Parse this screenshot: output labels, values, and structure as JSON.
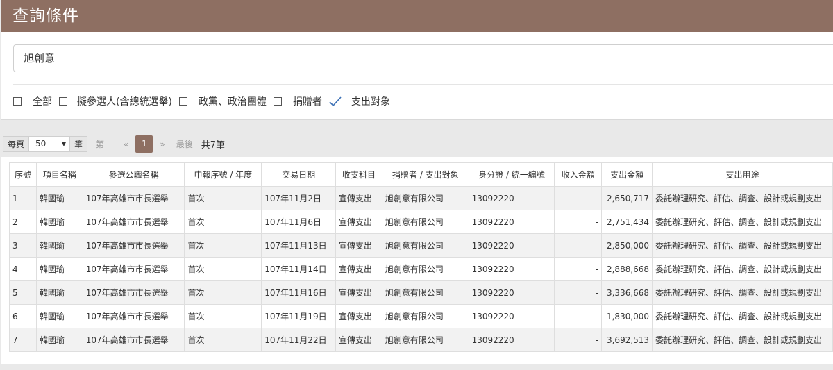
{
  "panel": {
    "title": "查詢條件",
    "search_value": "旭創意",
    "filters": [
      {
        "label": "全部",
        "checked": false
      },
      {
        "label": "擬參選人(含總統選舉)",
        "checked": false
      },
      {
        "label": "政黨、政治團體",
        "checked": false
      },
      {
        "label": "捐贈者",
        "checked": false
      },
      {
        "label": "支出對象",
        "checked": true
      }
    ]
  },
  "pager": {
    "per_page_label": "每頁",
    "per_page_value": "50",
    "unit_label": "筆",
    "first_label": "第一",
    "prev_label": "«",
    "current_page": "1",
    "next_label": "»",
    "last_label": "最後",
    "total_label": "共7筆"
  },
  "table": {
    "headers": [
      "序號",
      "項目名稱",
      "參選公職名稱",
      "申報序號 / 年度",
      "交易日期",
      "收支科目",
      "捐贈者 / 支出對象",
      "身分證 / 統一編號",
      "收入金額",
      "支出金額",
      "支出用途"
    ],
    "rows": [
      [
        "1",
        "韓國瑜",
        "107年高雄市市長選舉",
        "首次",
        "107年11月2日",
        "宣傳支出",
        "旭創意有限公司",
        "13092220",
        "-",
        "2,650,717",
        "委託辦理研究、評估、調查、設計或規劃支出"
      ],
      [
        "2",
        "韓國瑜",
        "107年高雄市市長選舉",
        "首次",
        "107年11月6日",
        "宣傳支出",
        "旭創意有限公司",
        "13092220",
        "-",
        "2,751,434",
        "委託辦理研究、評估、調查、設計或規劃支出"
      ],
      [
        "3",
        "韓國瑜",
        "107年高雄市市長選舉",
        "首次",
        "107年11月13日",
        "宣傳支出",
        "旭創意有限公司",
        "13092220",
        "-",
        "2,850,000",
        "委託辦理研究、評估、調查、設計或規劃支出"
      ],
      [
        "4",
        "韓國瑜",
        "107年高雄市市長選舉",
        "首次",
        "107年11月14日",
        "宣傳支出",
        "旭創意有限公司",
        "13092220",
        "-",
        "2,888,668",
        "委託辦理研究、評估、調查、設計或規劃支出"
      ],
      [
        "5",
        "韓國瑜",
        "107年高雄市市長選舉",
        "首次",
        "107年11月16日",
        "宣傳支出",
        "旭創意有限公司",
        "13092220",
        "-",
        "3,336,668",
        "委託辦理研究、評估、調查、設計或規劃支出"
      ],
      [
        "6",
        "韓國瑜",
        "107年高雄市市長選舉",
        "首次",
        "107年11月19日",
        "宣傳支出",
        "旭創意有限公司",
        "13092220",
        "-",
        "1,830,000",
        "委託辦理研究、評估、調查、設計或規劃支出"
      ],
      [
        "7",
        "韓國瑜",
        "107年高雄市市長選舉",
        "首次",
        "107年11月22日",
        "宣傳支出",
        "旭創意有限公司",
        "13092220",
        "-",
        "3,692,513",
        "委託辦理研究、評估、調查、設計或規劃支出"
      ]
    ]
  }
}
